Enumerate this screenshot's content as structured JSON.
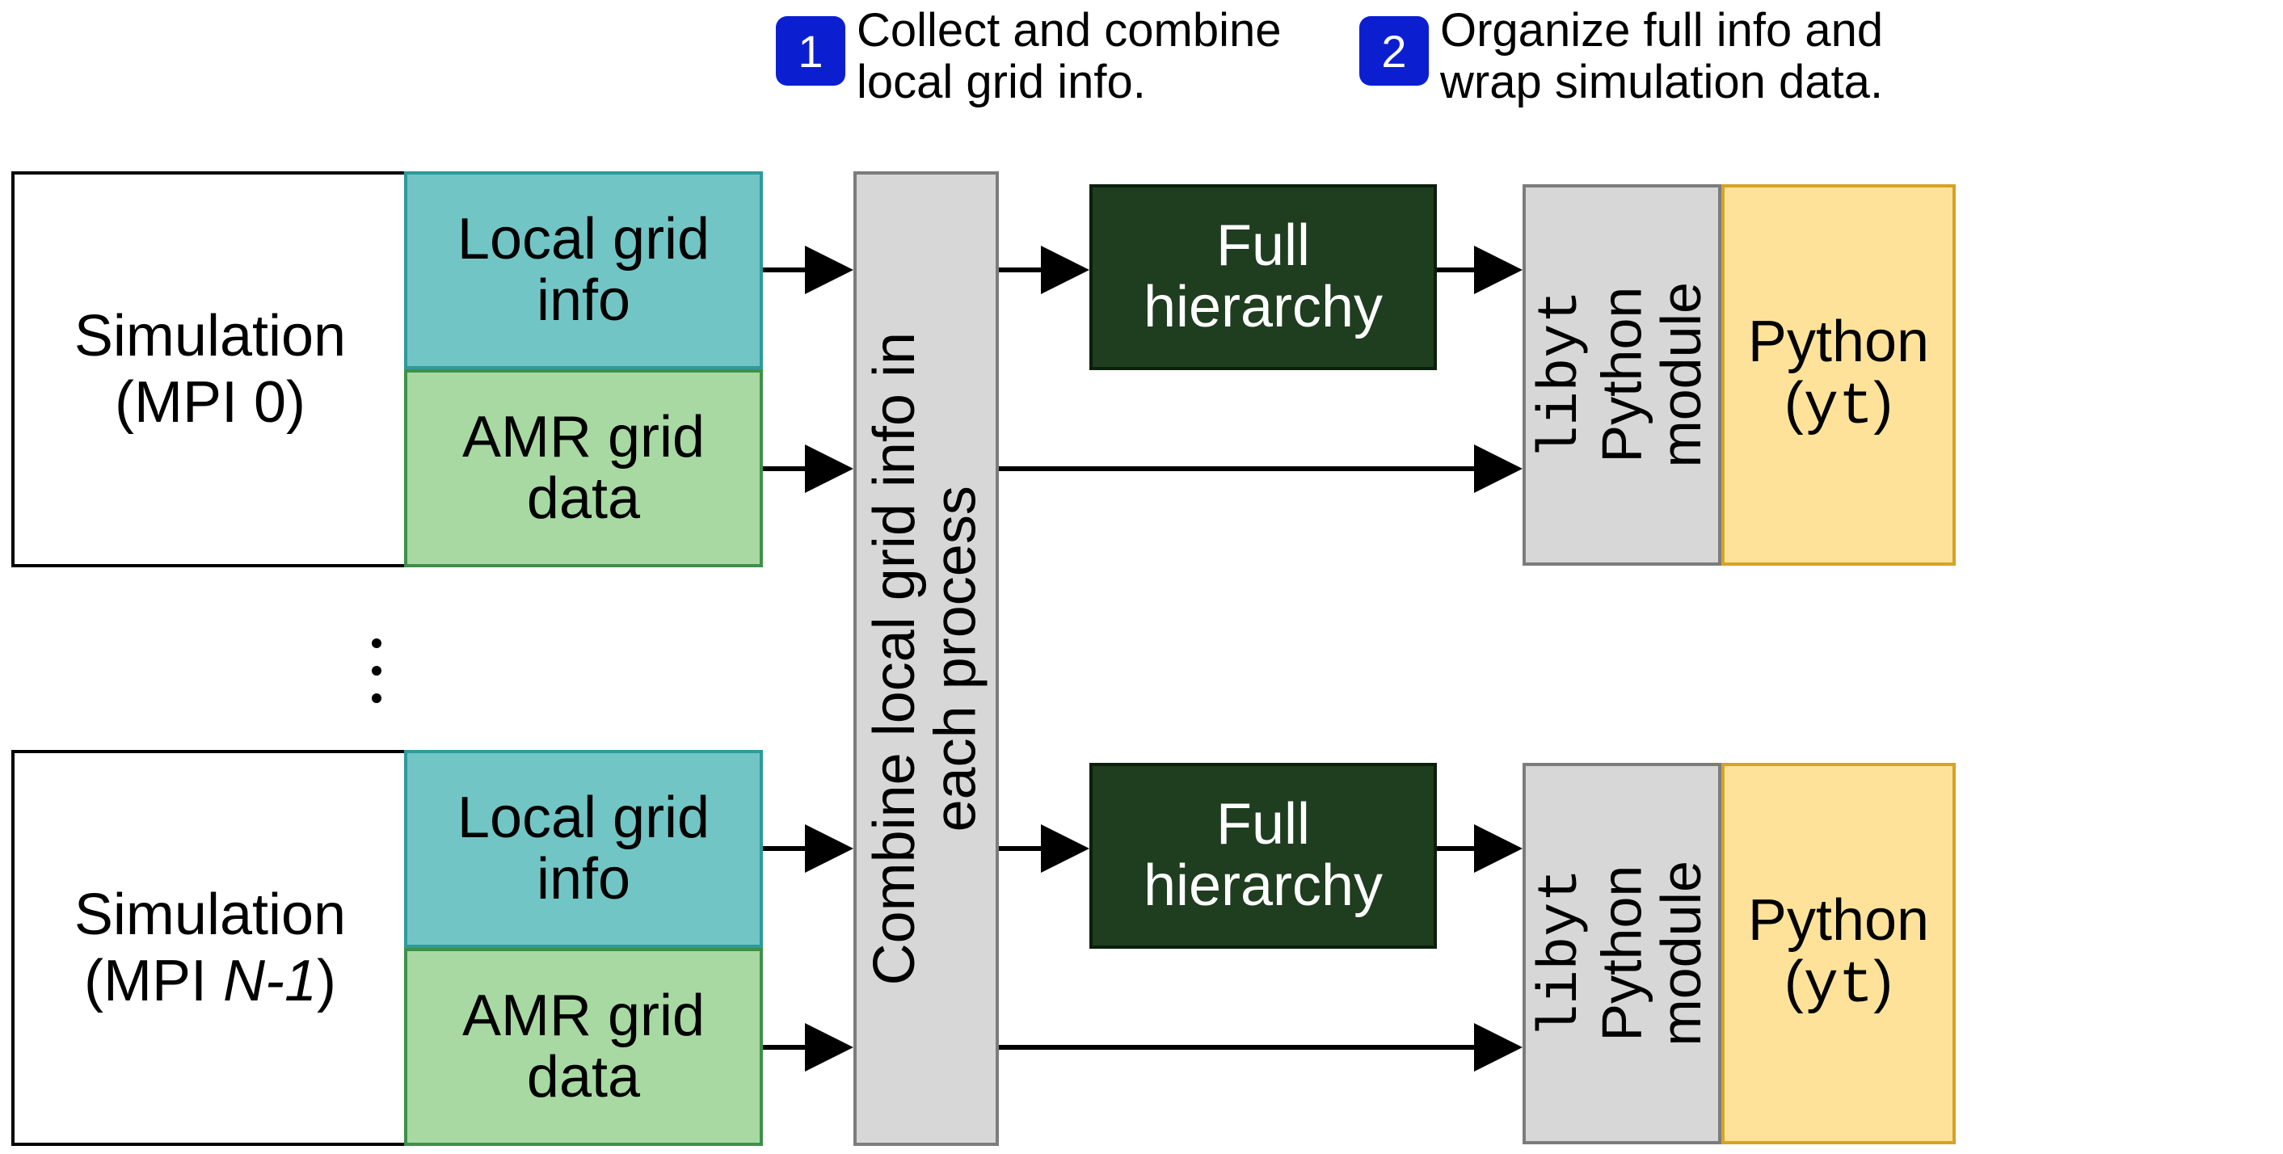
{
  "captions": {
    "badge1_num": "1",
    "badge1_line1": "Collect and combine",
    "badge1_line2": "local grid info.",
    "badge2_num": "2",
    "badge2_line1": "Organize full info and",
    "badge2_line2": "wrap simulation data."
  },
  "procTop": {
    "sim_line1": "Simulation",
    "sim_line2": "(MPI 0)",
    "local_line1": "Local grid",
    "local_line2": "info",
    "amr_line1": "AMR grid",
    "amr_line2": "data"
  },
  "procBot": {
    "sim_line1": "Simulation",
    "sim_line2_prefix": "(MPI ",
    "sim_line2_var": "N-1",
    "sim_line2_suffix": ")",
    "local_line1": "Local grid",
    "local_line2": "info",
    "amr_line1": "AMR grid",
    "amr_line2": "data"
  },
  "combine": {
    "line1": "Combine local grid info in",
    "line2": "each process"
  },
  "full": {
    "line1": "Full",
    "line2": "hierarchy"
  },
  "libyt": {
    "l1": "libyt",
    "l2": "Python",
    "l3": "module"
  },
  "python": {
    "line1": "Python",
    "line2_prefix": "(",
    "line2_mono": "yt",
    "line2_suffix": ")"
  }
}
